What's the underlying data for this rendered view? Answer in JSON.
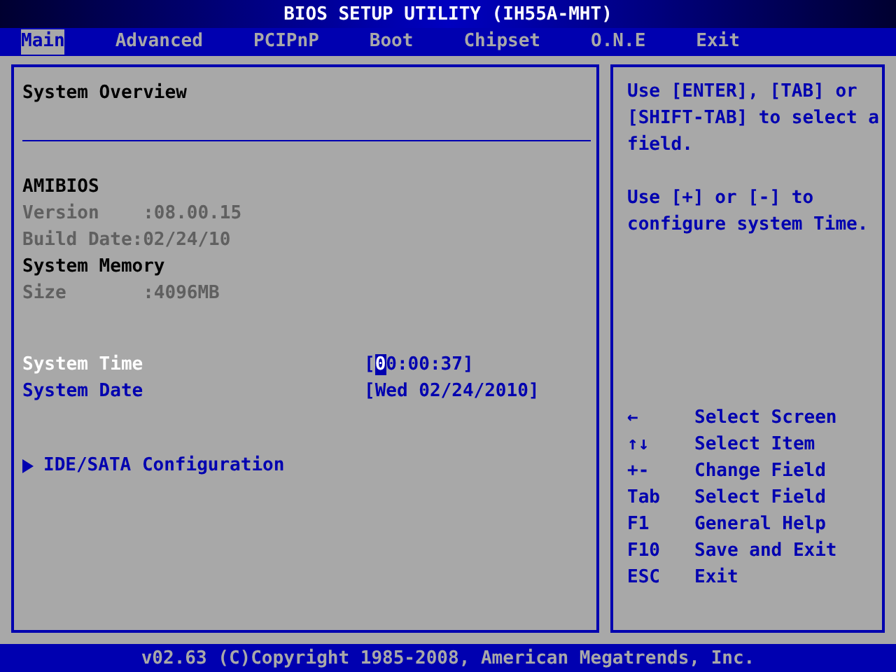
{
  "window": {
    "title": "BIOS SETUP UTILITY (IH55A-MHT)"
  },
  "tabs": [
    {
      "label": "Main",
      "selected": true
    },
    {
      "label": "Advanced",
      "selected": false
    },
    {
      "label": "PCIPnP",
      "selected": false
    },
    {
      "label": "Boot",
      "selected": false
    },
    {
      "label": "Chipset",
      "selected": false
    },
    {
      "label": "O.N.E",
      "selected": false
    },
    {
      "label": "Exit",
      "selected": false
    }
  ],
  "main": {
    "heading": "System Overview",
    "info": [
      {
        "kind": "header",
        "text": "AMIBIOS"
      },
      {
        "kind": "detail",
        "text": "Version    :08.00.15"
      },
      {
        "kind": "detail",
        "text": "Build Date:02/24/10"
      },
      {
        "kind": "header",
        "text": "System Memory"
      },
      {
        "kind": "detail",
        "text": "Size       :4096MB"
      }
    ],
    "settings": [
      {
        "label": "System Time",
        "selected": true,
        "value_parts": [
          {
            "text": "[",
            "selected": false
          },
          {
            "text": "0",
            "selected": true
          },
          {
            "text": "0:00:37]",
            "selected": false
          }
        ]
      },
      {
        "label": "System Date",
        "selected": false,
        "value_parts": [
          {
            "text": "[Wed 02/24/2010]",
            "selected": false
          }
        ]
      }
    ],
    "submenus": [
      {
        "label": "IDE/SATA Configuration"
      }
    ]
  },
  "help": {
    "paragraphs": [
      "Use [ENTER], [TAB] or [SHIFT-TAB] to select a field.",
      "Use [+] or [-] to configure system Time."
    ],
    "keys": [
      {
        "key": "←",
        "action": "Select Screen"
      },
      {
        "key": "↑↓",
        "action": "Select Item"
      },
      {
        "key": "+-",
        "action": "Change Field"
      },
      {
        "key": "Tab",
        "action": "Select Field"
      },
      {
        "key": "F1",
        "action": "General Help"
      },
      {
        "key": "F10",
        "action": "Save and Exit"
      },
      {
        "key": "ESC",
        "action": "Exit"
      }
    ]
  },
  "status_bar": {
    "text": "v02.63 (C)Copyright 1985-2008, American Megatrends, Inc."
  }
}
